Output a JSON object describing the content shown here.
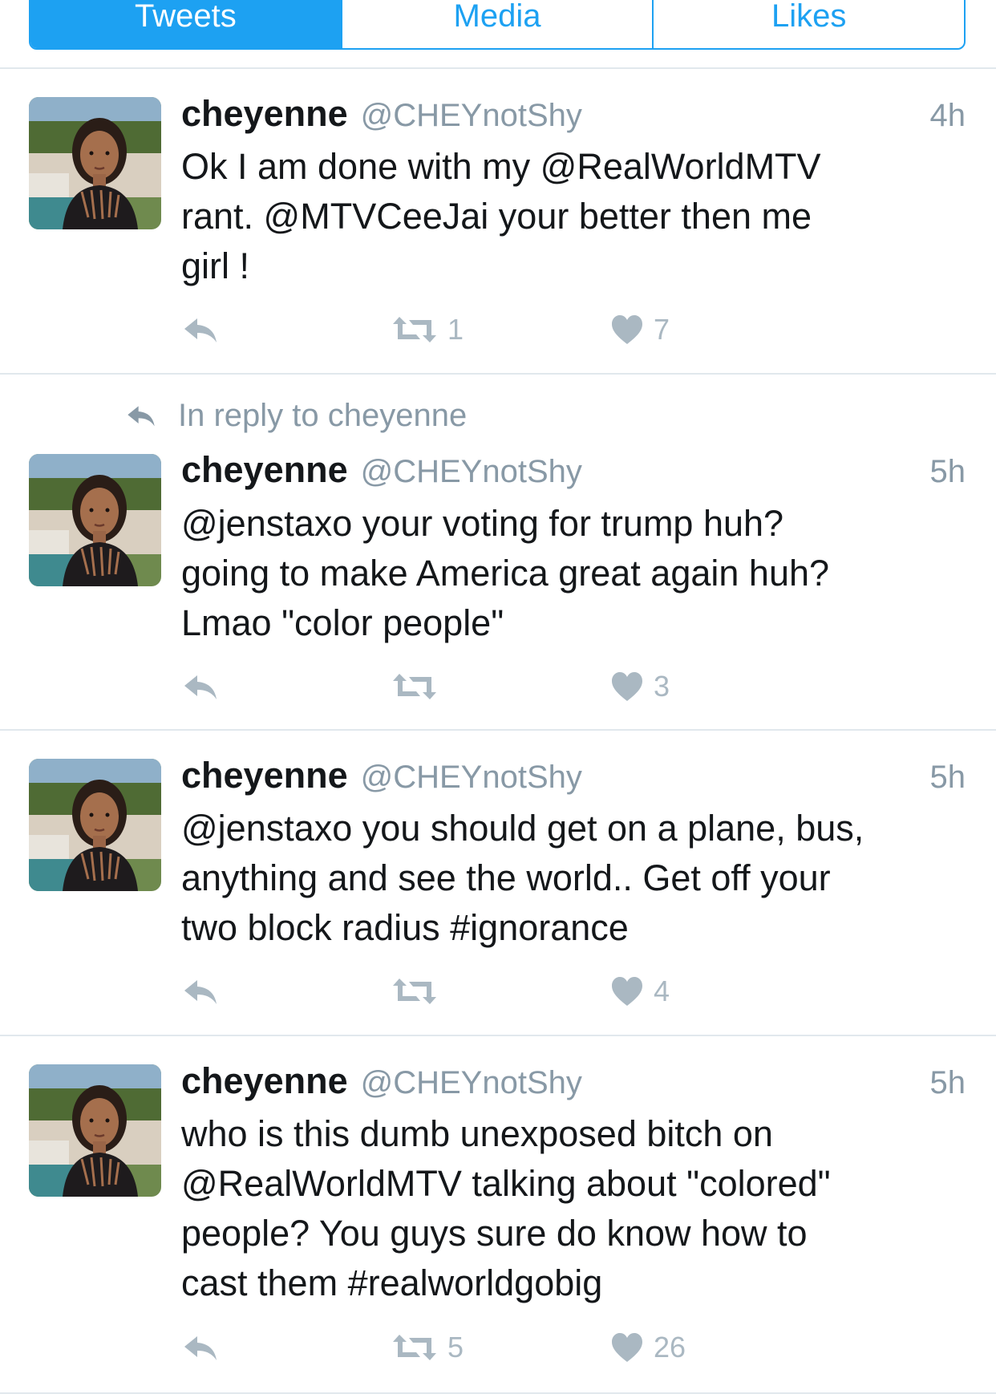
{
  "tabs": [
    {
      "label": "Tweets",
      "active": true
    },
    {
      "label": "Media",
      "active": false
    },
    {
      "label": "Likes",
      "active": false
    }
  ],
  "colors": {
    "accent": "#1da1f2",
    "muted": "#8899a6",
    "icon": "#aab8c2",
    "text": "#14171a",
    "divider": "#e1e8ed"
  },
  "icons": {
    "reply": "reply-arrow-icon",
    "retweet": "retweet-icon",
    "like": "heart-icon"
  },
  "tweets": [
    {
      "reply_context": "",
      "name": "cheyenne",
      "handle": "@CHEYnotShy",
      "time": "4h",
      "text": "Ok I am done with my @RealWorldMTV\nrant. @MTVCeeJai your better then me\ngirl !",
      "retweets": "1",
      "likes": "7"
    },
    {
      "reply_context": "In reply to cheyenne",
      "name": "cheyenne",
      "handle": "@CHEYnotShy",
      "time": "5h",
      "text": "@jenstaxo your voting for trump huh?\ngoing to make America great again huh?\nLmao \"color people\"",
      "retweets": "",
      "likes": "3"
    },
    {
      "reply_context": "",
      "name": "cheyenne",
      "handle": "@CHEYnotShy",
      "time": "5h",
      "text": "@jenstaxo you should get on a plane, bus,\nanything and see the world.. Get off your\ntwo block radius #ignorance",
      "retweets": "",
      "likes": "4"
    },
    {
      "reply_context": "",
      "name": "cheyenne",
      "handle": "@CHEYnotShy",
      "time": "5h",
      "text": "who is this dumb unexposed bitch on\n@RealWorldMTV talking about \"colored\"\npeople? You guys sure do know how to\ncast them #realworldgobig",
      "retweets": "5",
      "likes": "26"
    }
  ]
}
